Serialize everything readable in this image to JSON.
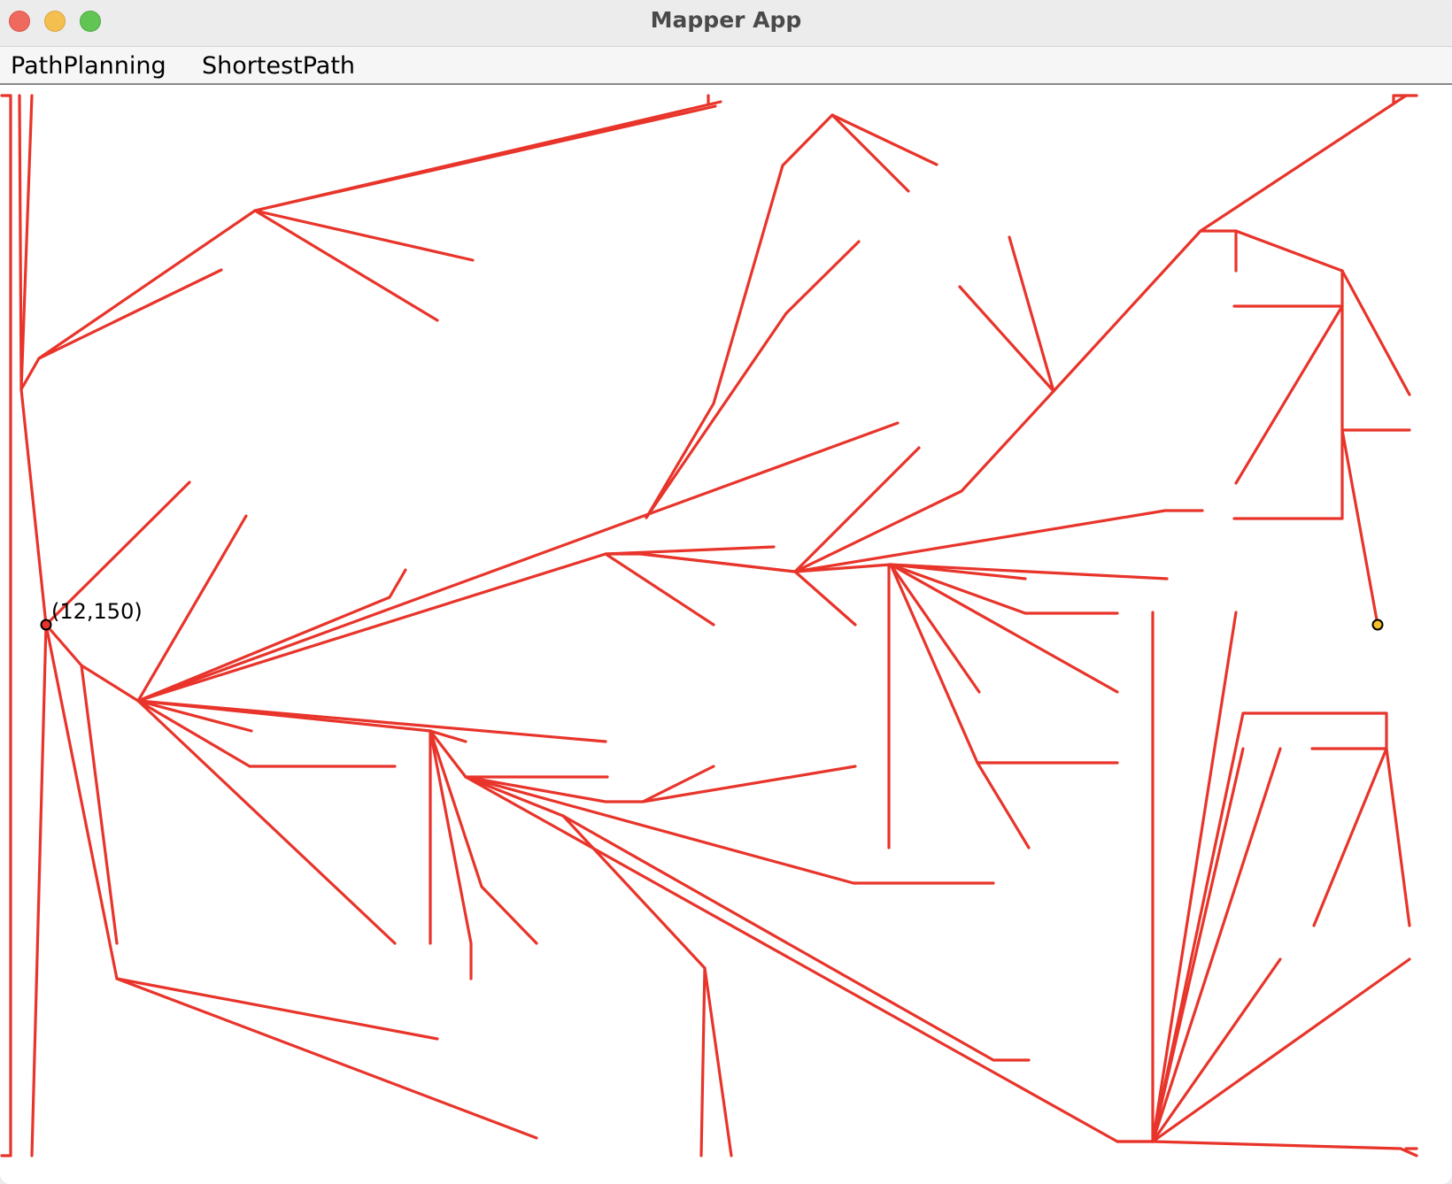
{
  "window": {
    "title": "Mapper App"
  },
  "menu": {
    "items": [
      {
        "label": "PathPlanning"
      },
      {
        "label": "ShortestPath"
      }
    ]
  },
  "map": {
    "tree_color": "#e8342a",
    "start_label": "(12,150)",
    "start_marker_color": "#e8342a",
    "goal_marker_color": "#f5c02a"
  }
}
